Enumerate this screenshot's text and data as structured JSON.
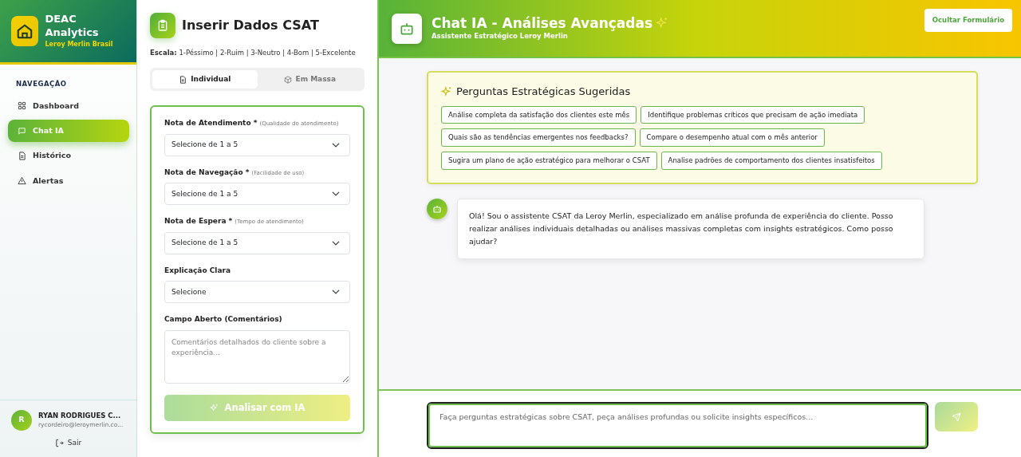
{
  "brand": {
    "title": "DEAC Analytics",
    "subtitle": "Leroy Merlin Brasil"
  },
  "nav": {
    "heading": "NAVEGAÇÃO",
    "items": [
      {
        "label": "Dashboard",
        "selected": false
      },
      {
        "label": "Chat IA",
        "selected": true
      },
      {
        "label": "Histórico",
        "selected": false
      },
      {
        "label": "Alertas",
        "selected": false
      }
    ]
  },
  "user": {
    "initial": "R",
    "name": "RYAN RODRIGUES C...",
    "email": "rycordeiro@leroymerlin.co...",
    "logout": "Sair"
  },
  "form": {
    "title": "Inserir Dados CSAT",
    "scale_label": "Escala:",
    "scale": "1-Péssimo | 2-Ruim | 3-Neutro | 4-Bom | 5-Excelente",
    "tabs": [
      {
        "label": "Individual",
        "selected": true
      },
      {
        "label": "Em Massa",
        "selected": false
      }
    ],
    "fields": [
      {
        "kind": "select",
        "label": "Nota de Atendimento *",
        "hint": "(Qualidade do atendimento)",
        "value": "Selecione de 1 a 5"
      },
      {
        "kind": "select",
        "label": "Nota de Navegação *",
        "hint": "(Facilidade de uso)",
        "value": "Selecione de 1 a 5"
      },
      {
        "kind": "select",
        "label": "Nota de Espera *",
        "hint": "(Tempo de atendimento)",
        "value": "Selecione de 1 a 5"
      },
      {
        "kind": "select",
        "label": "Explicação Clara",
        "value": "Selecione"
      },
      {
        "kind": "textarea",
        "label": "Campo Aberto (Comentários)",
        "placeholder": "Comentários detalhados do cliente sobre a experiência..."
      }
    ],
    "submit": {
      "label": "Analisar com IA",
      "disabled": true
    }
  },
  "chat": {
    "title": "Chat IA - Análises Avançadas",
    "subtitle": "Assistente Estratégico Leroy Merlin",
    "hide_button": "Ocultar Formulário",
    "suggestions": {
      "title": "Perguntas Estratégicas Sugeridas",
      "items": [
        "Análise completa da satisfação dos clientes este mês",
        "Identifique problemas críticos que precisam de ação imediata",
        "Quais são as tendências emergentes nos feedbacks?",
        "Compare o desempenho atual com o mês anterior",
        "Sugira um plano de ação estratégico para melhorar o CSAT",
        "Analise padrões de comportamento dos clientes insatisfeitos"
      ]
    },
    "messages": [
      {
        "text": "Olá! Sou o assistente CSAT da Leroy Merlin, especializado em análise profunda de experiência do cliente. Posso realizar análises individuais detalhadas ou análises massivas completas com insights estratégicos. Como posso ajudar?"
      }
    ],
    "input": {
      "placeholder": "Faça perguntas estratégicas sobre CSAT, peça análises profundas ou solicite insights específicos..."
    },
    "send": {
      "disabled": true
    }
  }
}
